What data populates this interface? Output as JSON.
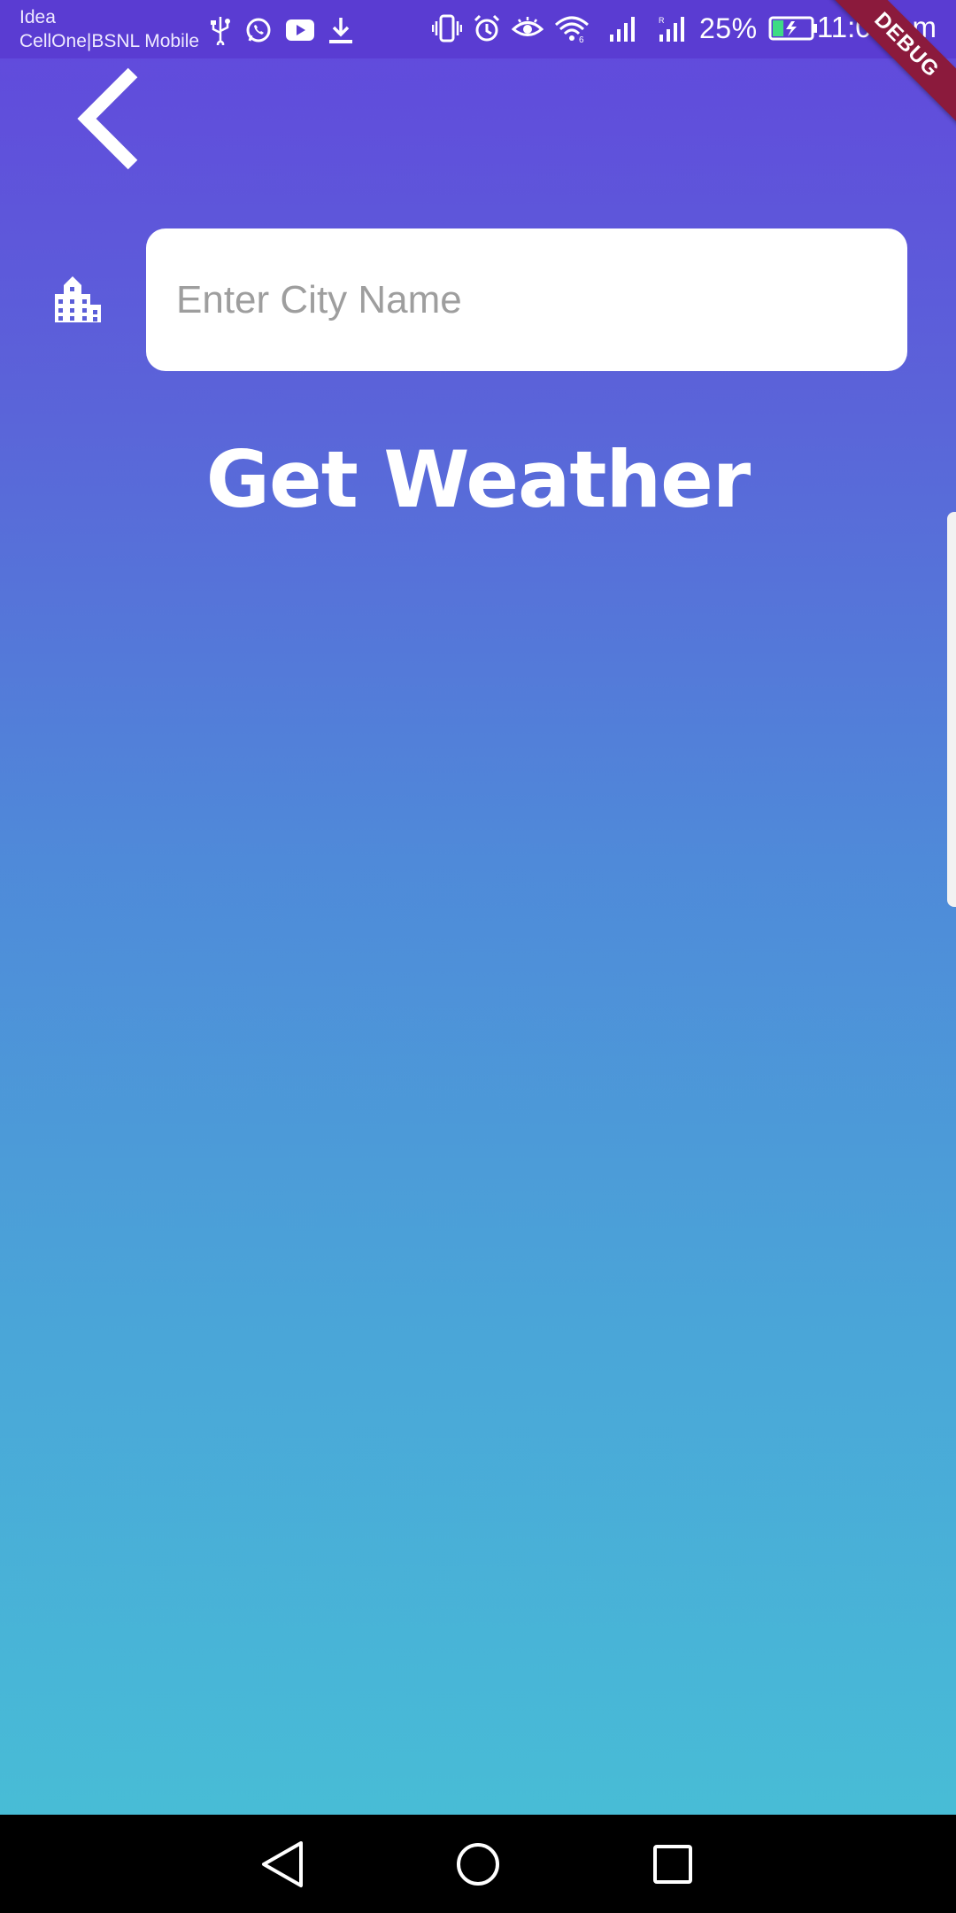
{
  "status_bar": {
    "carrier_primary": "Idea",
    "carrier_secondary": "CellOne|BSNL Mobile",
    "battery_percent": "25%",
    "time": "11:09 pm",
    "icons_left": [
      "usb-icon",
      "whatsapp-icon",
      "youtube-icon",
      "download-icon"
    ],
    "icons_right": [
      "vibrate-icon",
      "alarm-icon",
      "eye-comfort-icon",
      "wifi-icon",
      "signal-icon",
      "signal-r-icon",
      "battery-charging-icon"
    ]
  },
  "debug_banner": "DEBUG",
  "city_field": {
    "placeholder": "Enter City Name",
    "value": ""
  },
  "get_weather_label": "Get Weather",
  "colors": {
    "gradient_top": "#6247dc",
    "gradient_bottom": "#47c1d6",
    "debug_ribbon": "#8b1a3c",
    "battery_fill": "#3ddc84"
  }
}
